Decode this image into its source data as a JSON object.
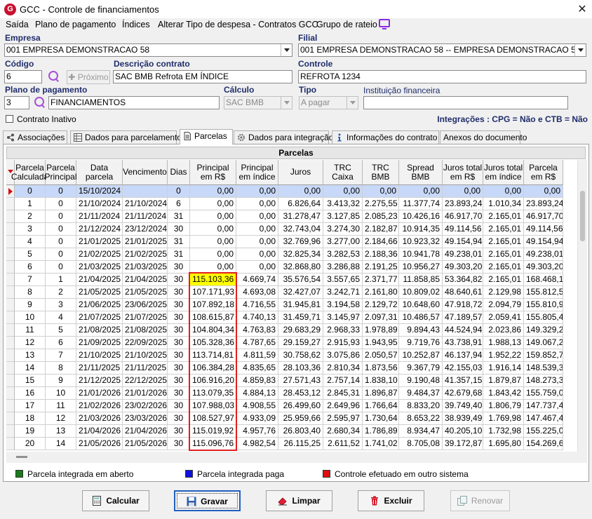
{
  "window": {
    "title": "GCC - Controle de financiamentos",
    "close_label": "✕"
  },
  "menu": [
    "Saída",
    "Plano de pagamento",
    "Índices",
    "Alterar Tipo de despesa - Contratos GCC",
    "Grupo de rateio"
  ],
  "form": {
    "empresa": {
      "label": "Empresa",
      "value": "001 EMPRESA DEMONSTRACAO 58"
    },
    "filial": {
      "label": "Filial",
      "value": "001 EMPRESA DEMONSTRACAO 58 -- EMPRESA DEMONSTRACAO 58"
    },
    "codigo": {
      "label": "Código",
      "value": "6"
    },
    "proximo_label": "Próximo",
    "descricao": {
      "label": "Descrição contrato",
      "value": "SAC BMB Refrota EM ÍNDICE"
    },
    "controle": {
      "label": "Controle",
      "value": "REFROTA 1234"
    },
    "plano": {
      "label": "Plano de pagamento",
      "code": "3",
      "value": "FINANCIAMENTOS"
    },
    "calculo": {
      "label": "Cálculo",
      "value": "SAC BMB"
    },
    "tipo": {
      "label": "Tipo",
      "value": "A pagar"
    },
    "instituicao": {
      "label": "Instituição financeira",
      "value": ""
    },
    "contrato_inativo_label": "Contrato Inativo",
    "integracoes": "Integrações : CPG = Não e CTB = Não"
  },
  "tabs": [
    "Associações",
    "Dados para parcelamento",
    "Parcelas",
    "Dados para integração",
    "Informações do contrato",
    "Anexos do documento"
  ],
  "grid": {
    "caption": "Parcelas",
    "columns": [
      "Parcela\nCalculada",
      "Parcela\nPrincipal",
      "Data parcela",
      "Vencimento",
      "Dias",
      "Principal\nem R$",
      "Principal\nem índice",
      "Juros",
      "TRC Caixa",
      "TRC BMB",
      "Spread BMB",
      "Juros total\nem R$",
      "Juros total\nem índice",
      "Parcela\nem R$"
    ],
    "rows": [
      [
        "0",
        "0",
        "15/10/2024",
        "",
        "0",
        "0,00",
        "0,00",
        "0,00",
        "0,00",
        "0,00",
        "0,00",
        "0,00",
        "0,00",
        "0,00"
      ],
      [
        "1",
        "0",
        "21/10/2024",
        "21/10/2024",
        "6",
        "0,00",
        "0,00",
        "6.826,64",
        "3.413,32",
        "2.275,55",
        "11.377,74",
        "23.893,24",
        "1.010,34",
        "23.893,24"
      ],
      [
        "2",
        "0",
        "21/11/2024",
        "21/11/2024",
        "31",
        "0,00",
        "0,00",
        "31.278,47",
        "3.127,85",
        "2.085,23",
        "10.426,16",
        "46.917,70",
        "2.165,01",
        "46.917,70"
      ],
      [
        "3",
        "0",
        "21/12/2024",
        "23/12/2024",
        "30",
        "0,00",
        "0,00",
        "32.743,04",
        "3.274,30",
        "2.182,87",
        "10.914,35",
        "49.114,56",
        "2.165,01",
        "49.114,56"
      ],
      [
        "4",
        "0",
        "21/01/2025",
        "21/01/2025",
        "31",
        "0,00",
        "0,00",
        "32.769,96",
        "3.277,00",
        "2.184,66",
        "10.923,32",
        "49.154,94",
        "2.165,01",
        "49.154,94"
      ],
      [
        "5",
        "0",
        "21/02/2025",
        "21/02/2025",
        "31",
        "0,00",
        "0,00",
        "32.825,34",
        "3.282,53",
        "2.188,36",
        "10.941,78",
        "49.238,01",
        "2.165,01",
        "49.238,01"
      ],
      [
        "6",
        "0",
        "21/03/2025",
        "21/03/2025",
        "30",
        "0,00",
        "0,00",
        "32.868,80",
        "3.286,88",
        "2.191,25",
        "10.956,27",
        "49.303,20",
        "2.165,01",
        "49.303,20"
      ],
      [
        "7",
        "1",
        "21/04/2025",
        "21/04/2025",
        "30",
        "115.103,36",
        "4.669,74",
        "35.576,54",
        "3.557,65",
        "2.371,77",
        "11.858,85",
        "53.364,82",
        "2.165,01",
        "168.468,18"
      ],
      [
        "8",
        "2",
        "21/05/2025",
        "21/05/2025",
        "30",
        "107.171,93",
        "4.693,08",
        "32.427,07",
        "3.242,71",
        "2.161,80",
        "10.809,02",
        "48.640,61",
        "2.129,98",
        "155.812,54"
      ],
      [
        "9",
        "3",
        "21/06/2025",
        "23/06/2025",
        "30",
        "107.892,18",
        "4.716,55",
        "31.945,81",
        "3.194,58",
        "2.129,72",
        "10.648,60",
        "47.918,72",
        "2.094,79",
        "155.810,90"
      ],
      [
        "10",
        "4",
        "21/07/2025",
        "21/07/2025",
        "30",
        "108.615,87",
        "4.740,13",
        "31.459,71",
        "3.145,97",
        "2.097,31",
        "10.486,57",
        "47.189,57",
        "2.059,41",
        "155.805,43"
      ],
      [
        "11",
        "5",
        "21/08/2025",
        "21/08/2025",
        "30",
        "104.804,34",
        "4.763,83",
        "29.683,29",
        "2.968,33",
        "1.978,89",
        "9.894,43",
        "44.524,94",
        "2.023,86",
        "149.329,28"
      ],
      [
        "12",
        "6",
        "21/09/2025",
        "22/09/2025",
        "30",
        "105.328,36",
        "4.787,65",
        "29.159,27",
        "2.915,93",
        "1.943,95",
        "9.719,76",
        "43.738,91",
        "1.988,13",
        "149.067,27"
      ],
      [
        "13",
        "7",
        "21/10/2025",
        "21/10/2025",
        "30",
        "113.714,81",
        "4.811,59",
        "30.758,62",
        "3.075,86",
        "2.050,57",
        "10.252,87",
        "46.137,94",
        "1.952,22",
        "159.852,75"
      ],
      [
        "14",
        "8",
        "21/11/2025",
        "21/11/2025",
        "30",
        "106.384,28",
        "4.835,65",
        "28.103,36",
        "2.810,34",
        "1.873,56",
        "9.367,79",
        "42.155,03",
        "1.916,14",
        "148.539,31"
      ],
      [
        "15",
        "9",
        "21/12/2025",
        "22/12/2025",
        "30",
        "106.916,20",
        "4.859,83",
        "27.571,43",
        "2.757,14",
        "1.838,10",
        "9.190,48",
        "41.357,15",
        "1.879,87",
        "148.273,35"
      ],
      [
        "16",
        "10",
        "21/01/2026",
        "21/01/2026",
        "30",
        "113.079,35",
        "4.884,13",
        "28.453,12",
        "2.845,31",
        "1.896,87",
        "9.484,37",
        "42.679,68",
        "1.843,42",
        "155.759,03"
      ],
      [
        "17",
        "11",
        "21/02/2026",
        "23/02/2026",
        "30",
        "107.988,03",
        "4.908,55",
        "26.499,60",
        "2.649,96",
        "1.766,64",
        "8.833,20",
        "39.749,40",
        "1.806,79",
        "147.737,43"
      ],
      [
        "18",
        "12",
        "21/03/2026",
        "23/03/2026",
        "30",
        "108.527,97",
        "4.933,09",
        "25.959,66",
        "2.595,97",
        "1.730,64",
        "8.653,22",
        "38.939,49",
        "1.769,98",
        "147.467,46"
      ],
      [
        "19",
        "13",
        "21/04/2026",
        "21/04/2026",
        "30",
        "115.019,92",
        "4.957,76",
        "26.803,40",
        "2.680,34",
        "1.786,89",
        "8.934,47",
        "40.205,10",
        "1.732,98",
        "155.225,02"
      ],
      [
        "20",
        "14",
        "21/05/2026",
        "21/05/2026",
        "30",
        "115.096,76",
        "4.982,54",
        "26.115,25",
        "2.611,52",
        "1.741,02",
        "8.705,08",
        "39.172,87",
        "1.695,80",
        "154.269,64"
      ]
    ]
  },
  "legend": [
    {
      "label": "Parcela integrada em aberto",
      "color": "#1a7a1a"
    },
    {
      "label": "Parcela integrada paga",
      "color": "#1010e0"
    },
    {
      "label": "Controle efetuado em outro sistema",
      "color": "#e01010"
    }
  ],
  "buttons": {
    "calcular": "Calcular",
    "gravar": "Gravar",
    "limpar": "Limpar",
    "excluir": "Excluir",
    "renovar": "Renovar"
  },
  "colors": {
    "accent": "#1f2d6b",
    "highlight_box": "#e02020",
    "highlight_cell": "#ffff00",
    "selected_row": "#c8d8f8",
    "search_icon": "#a64fd6"
  }
}
